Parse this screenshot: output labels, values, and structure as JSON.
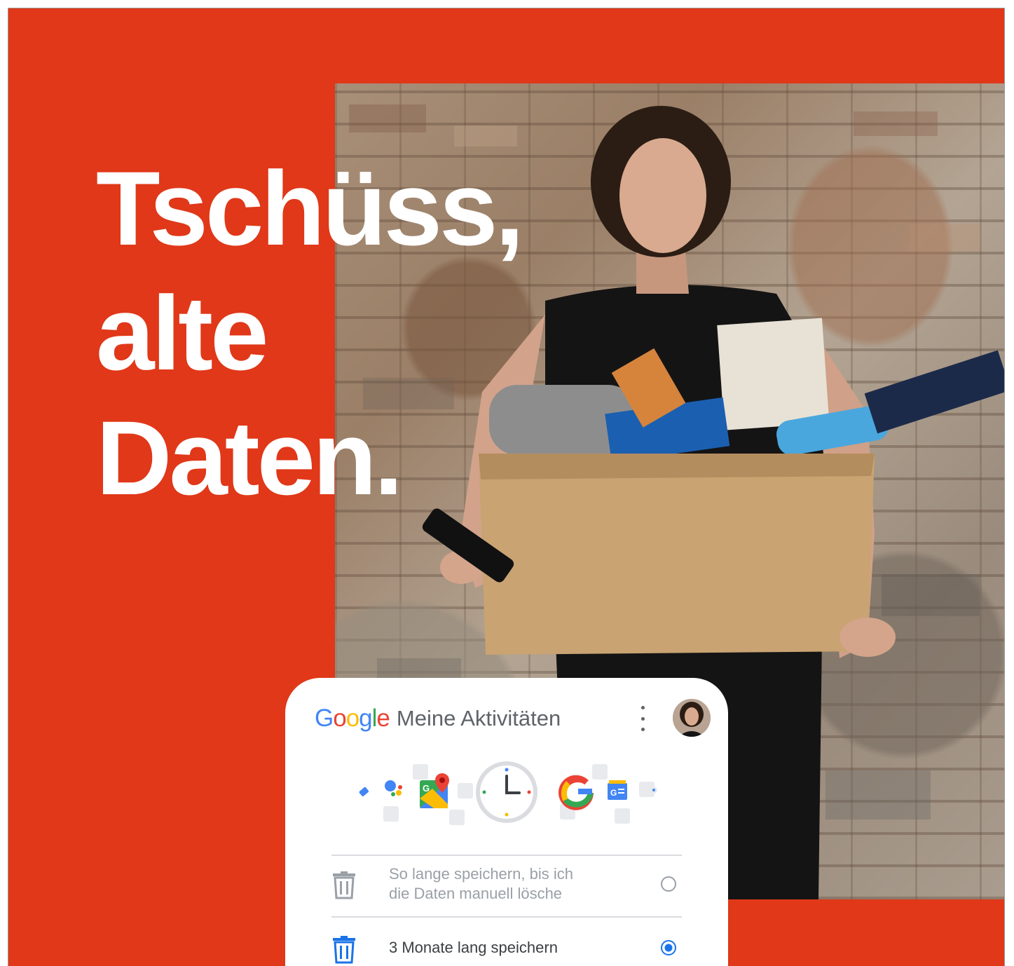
{
  "headline": {
    "lines": [
      "Tschüss,",
      "alte",
      "Daten."
    ]
  },
  "card": {
    "brand": "Google",
    "product": "Meine Aktivitäten",
    "more_icon": "more-vert-icon",
    "avatar": "user-avatar",
    "app_icons": [
      "tag-icon",
      "assistant-icon",
      "maps-icon",
      "clock-icon",
      "google-g-icon",
      "news-icon",
      "small-dot-icon"
    ],
    "options": [
      {
        "label_line1": "So lange speichern, bis ich",
        "label_line2": "die Daten manuell lösche",
        "selected": false,
        "icon": "trash-icon"
      },
      {
        "label": "3 Monate lang speichern",
        "selected": true,
        "icon": "trash-icon"
      }
    ]
  },
  "colors": {
    "background": "#e03819",
    "card": "#ffffff",
    "accent": "#1a73e8",
    "text_muted": "#9aa0a6",
    "text": "#3c4043"
  }
}
